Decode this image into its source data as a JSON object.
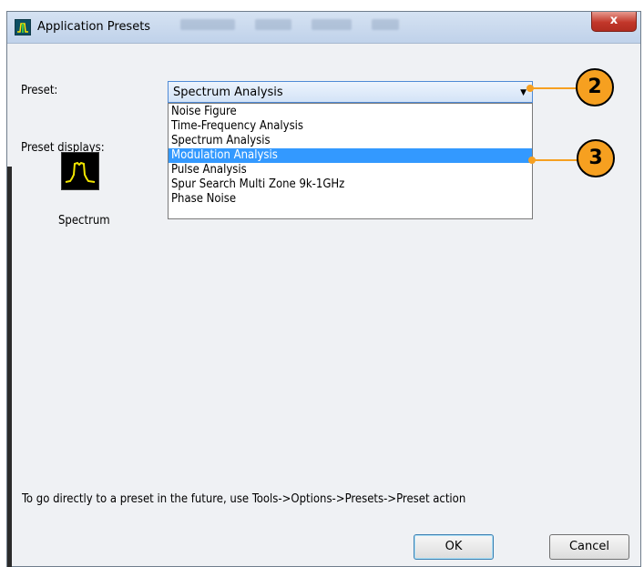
{
  "window": {
    "title": "Application Presets",
    "close_label": "x",
    "background_menu": [
      "Presets",
      "Tools",
      "Window",
      "Help"
    ]
  },
  "form": {
    "preset_label": "Preset:",
    "preset_value": "Spectrum Analysis",
    "displays_label": "Preset displays:",
    "options": [
      "Noise Figure",
      "Time-Frequency Analysis",
      "Spectrum Analysis",
      "Modulation Analysis",
      "Pulse Analysis",
      "Spur Search Multi Zone 9k-1GHz",
      "Phase Noise"
    ],
    "selected_option": "Modulation Analysis",
    "display_items": [
      {
        "label": "Spectrum",
        "icon": "spectrum-trace-icon"
      }
    ]
  },
  "callouts": [
    "2",
    "3"
  ],
  "hint": "To go directly to a preset in the future, use Tools->Options->Presets->Preset action",
  "buttons": {
    "ok": "OK",
    "cancel": "Cancel"
  },
  "colors": {
    "callout": "#f6a020",
    "selection": "#3399ff",
    "spectrum_trace": "#f2e600",
    "close_button": "#c2372a"
  }
}
